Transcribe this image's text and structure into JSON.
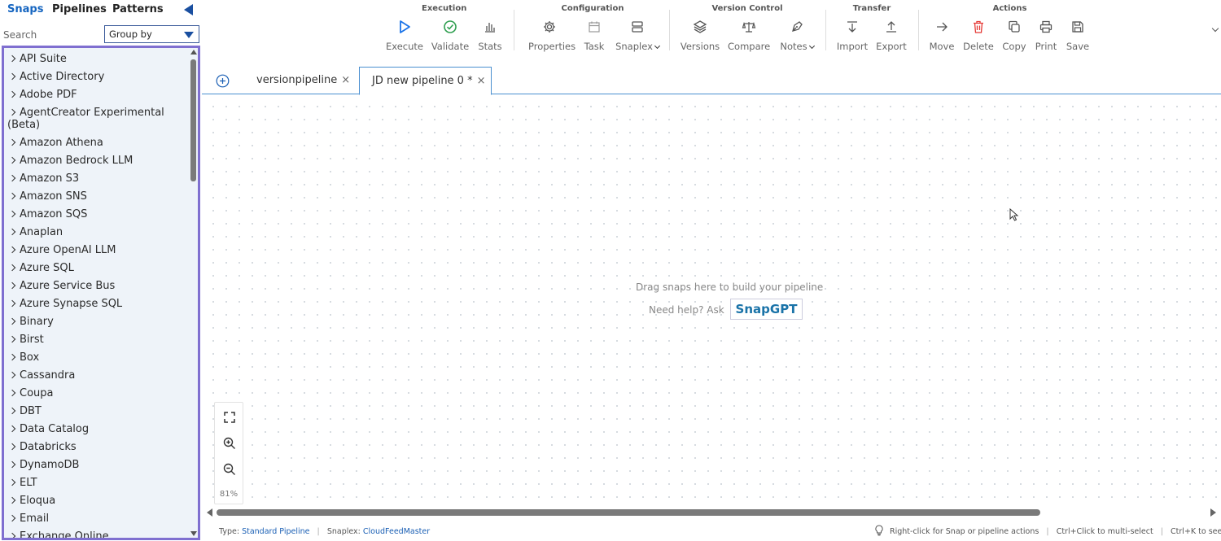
{
  "left_panel": {
    "tabs": [
      "Snaps",
      "Pipelines",
      "Patterns"
    ],
    "active_tab": "Snaps",
    "search_placeholder": "Search",
    "group_by_label": "Group by",
    "snap_categories": [
      "API Suite",
      "Active Directory",
      "Adobe PDF",
      "AgentCreator Experimental (Beta)",
      "Amazon Athena",
      "Amazon Bedrock LLM",
      "Amazon S3",
      "Amazon SNS",
      "Amazon SQS",
      "Anaplan",
      "Azure OpenAI LLM",
      "Azure SQL",
      "Azure Service Bus",
      "Azure Synapse SQL",
      "Binary",
      "Birst",
      "Box",
      "Cassandra",
      "Coupa",
      "DBT",
      "Data Catalog",
      "Databricks",
      "DynamoDB",
      "ELT",
      "Eloqua",
      "Email",
      "Exchange Online"
    ]
  },
  "toolbar": {
    "groups": {
      "execution": "Execution",
      "configuration": "Configuration",
      "version_control": "Version Control",
      "transfer": "Transfer",
      "actions": "Actions"
    },
    "buttons": {
      "execute": "Execute",
      "validate": "Validate",
      "stats": "Stats",
      "properties": "Properties",
      "task": "Task",
      "snaplex": "Snaplex",
      "versions": "Versions",
      "compare": "Compare",
      "notes": "Notes",
      "import": "Import",
      "export": "Export",
      "move": "Move",
      "delete": "Delete",
      "copy": "Copy",
      "print": "Print",
      "save": "Save"
    },
    "colors": {
      "execute": "#1a73e8",
      "validate": "#2e9e4f",
      "delete": "#e53935"
    }
  },
  "pipeline_tabs": [
    {
      "label": "versionpipeline",
      "close": "×"
    },
    {
      "label": "JD new pipeline 0 *",
      "close": "×"
    }
  ],
  "canvas": {
    "hint": "Drag snaps here to build your pipeline",
    "help_prefix": "Need help? Ask",
    "snapgpt_label": "SnapGPT",
    "zoom_level": "81%"
  },
  "status_bar": {
    "type_label": "Type:",
    "type_value": "Standard Pipeline",
    "snaplex_label": "Snaplex:",
    "snaplex_value": "CloudFeedMaster",
    "tip_right_click": "Right-click for Snap or pipeline actions",
    "tip_ctrl_click": "Ctrl+Click to multi-select",
    "tip_ctrl_k": "Ctrl+K to see all shortcuts"
  }
}
